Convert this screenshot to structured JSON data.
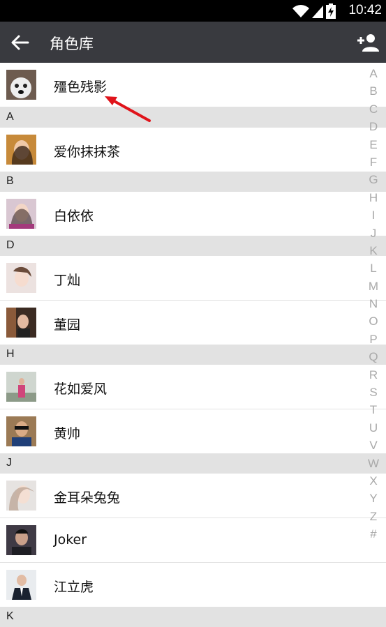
{
  "status": {
    "time": "10:42"
  },
  "appbar": {
    "title": "角色库"
  },
  "top_item": {
    "name": "殭色残影"
  },
  "sections": [
    {
      "letter": "A",
      "items": [
        {
          "name": "爱你抹抹茶"
        }
      ]
    },
    {
      "letter": "B",
      "items": [
        {
          "name": "白依依"
        }
      ]
    },
    {
      "letter": "D",
      "items": [
        {
          "name": "丁灿"
        },
        {
          "name": "董园"
        }
      ]
    },
    {
      "letter": "H",
      "items": [
        {
          "name": "花如爱风"
        },
        {
          "name": "黄帅"
        }
      ]
    },
    {
      "letter": "J",
      "items": [
        {
          "name": "金耳朵兔兔"
        },
        {
          "name": "Joker"
        },
        {
          "name": "江立虎"
        }
      ]
    },
    {
      "letter": "K",
      "items": []
    }
  ],
  "index_letters": [
    "A",
    "B",
    "C",
    "D",
    "E",
    "F",
    "G",
    "H",
    "I",
    "J",
    "K",
    "L",
    "M",
    "N",
    "O",
    "P",
    "Q",
    "R",
    "S",
    "T",
    "U",
    "V",
    "W",
    "X",
    "Y",
    "Z",
    "#"
  ],
  "colors": {
    "appbar": "#393a3f",
    "section_bg": "#e2e2e2",
    "arrow": "#e0141b"
  }
}
